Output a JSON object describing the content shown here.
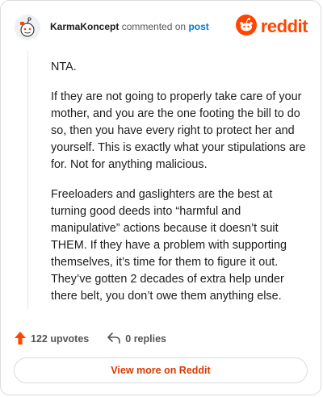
{
  "header": {
    "username": "KarmaKoncept",
    "action_text": "commented on",
    "post_link": "post",
    "brand_name": "reddit"
  },
  "comment": {
    "paragraphs": [
      "NTA.",
      "If they are not going to properly take care of your mother, and you are the one footing the bill to do so, then you have every right to protect her and yourself. This is exactly what your stipulations are for. Not for anything malicious.",
      "Freeloaders and gaslighters are the best at turning good deeds into “harmful and manipulative” actions because it doesn’t suit THEM. If they have a problem with supporting themselves, it’s time for them to figure it out. They’ve gotten 2 decades of extra help under there belt, you don’t owe them anything else."
    ]
  },
  "actions": {
    "upvotes": "122 upvotes",
    "replies": "0 replies"
  },
  "cta": {
    "label": "View more on Reddit"
  },
  "colors": {
    "brand": "#ff4500",
    "link": "#0079d3",
    "cta_text": "#d93900"
  },
  "icons": {
    "avatar": "snoo-avatar-icon",
    "brand": "reddit-logo-icon",
    "upvote": "upvote-arrow-icon",
    "reply": "reply-arrow-icon"
  }
}
